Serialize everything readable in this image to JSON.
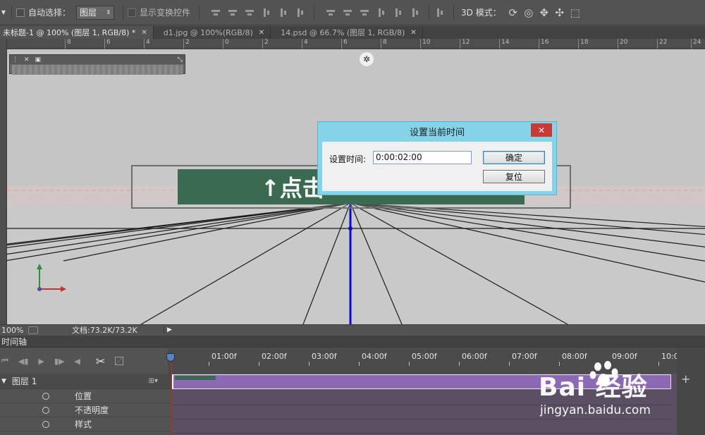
{
  "options_bar": {
    "auto_select_label": "自动选择：",
    "auto_select_value": "图层",
    "show_transform_label": "显示变换控件",
    "mode_3d_label": "3D 模式："
  },
  "tabs": [
    {
      "label": "未标题-1 @ 100% (图层 1, RGB/8) *",
      "active": true
    },
    {
      "label": "d1.jpg @ 100%(RGB/8)",
      "active": false
    },
    {
      "label": "14.psd @ 66.7% (图层 1, RGB/8)",
      "active": false
    }
  ],
  "ruler_labels": [
    "8",
    "6",
    "4",
    "2",
    "0",
    "2",
    "4",
    "6",
    "8",
    "10",
    "12",
    "14",
    "16",
    "18",
    "20",
    "22",
    "24"
  ],
  "sign_text": "↑点击",
  "status": {
    "zoom": "100%",
    "doc_size": "文档:73.2K/73.2K"
  },
  "timeline": {
    "panel_title": "时间轴",
    "ticks": [
      "01:00f",
      "02:00f",
      "03:00f",
      "04:00f",
      "05:00f",
      "06:00f",
      "07:00f",
      "08:00f",
      "09:00f",
      "10:0"
    ],
    "layer_name": "图层 1",
    "properties": [
      "位置",
      "不透明度",
      "样式"
    ]
  },
  "dialog": {
    "title": "设置当前时间",
    "close_label": "✕",
    "field_label": "设置时间:",
    "field_value": "0:00:02:00",
    "ok_label": "确定",
    "reset_label": "复位"
  },
  "watermark": {
    "logo": "Bai 经验",
    "url": "jingyan.baidu.com"
  },
  "colors": {
    "sign_green": "#3a6b50",
    "dialog_frame": "#84d3e8",
    "clip_purple": "#8c6ab3",
    "close_red": "#c83a33"
  }
}
